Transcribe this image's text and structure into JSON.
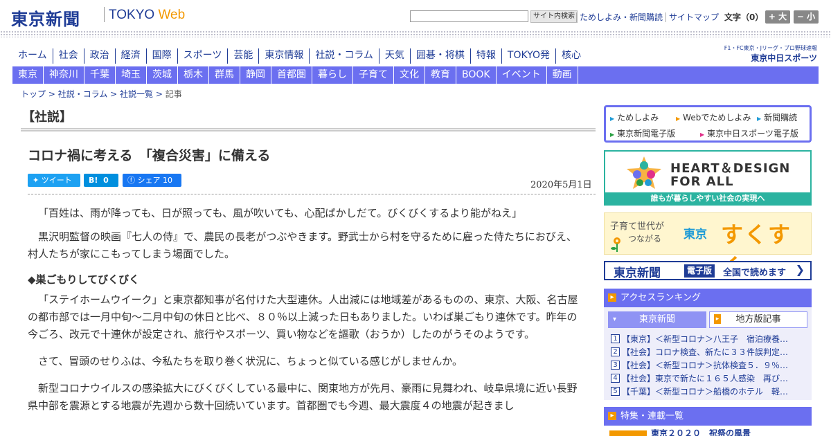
{
  "header": {
    "logo_main": "東京新聞",
    "logo_tokyo": "TOKYO",
    "logo_web": "Web",
    "search_button": "サイト内検索",
    "links": [
      "ためしよみ・新聞購読",
      "サイトマップ"
    ],
    "font_size_label": "文字（0）",
    "font_big": "+ 大",
    "font_small": "− 小"
  },
  "nav_main": [
    "ホーム",
    "社会",
    "政治",
    "経済",
    "国際",
    "スポーツ",
    "芸能",
    "東京情報",
    "社説・コラム",
    "天気",
    "囲碁・将棋",
    "特報",
    "TOKYO発",
    "核心"
  ],
  "sports_logo": {
    "line1": "F1・FC東京・Jリーグ・プロ野球速報",
    "line2": "東京中日スポーツ"
  },
  "nav_region": [
    "東京",
    "神奈川",
    "千葉",
    "埼玉",
    "茨城",
    "栃木",
    "群馬",
    "静岡",
    "首都圏",
    "暮らし",
    "子育て",
    "文化",
    "教育",
    "BOOK",
    "イベント",
    "動画"
  ],
  "breadcrumb": {
    "items": [
      "トップ",
      "社説・コラム",
      "社説一覧"
    ],
    "current": "記事",
    "sep": " > "
  },
  "article": {
    "section": "【社説】",
    "title": "コロナ禍に考える　「複合災害」に備える",
    "share": {
      "tweet": "ツイート",
      "hatena": "B!",
      "hatena_count": "0",
      "fb": "シェア",
      "fb_count": "10"
    },
    "date": "2020年5月1日",
    "p1": "「百姓は、雨が降っても、日が照っても、風が吹いても、心配ばかしだて。びくびくするより能がねえ」",
    "p2": "黒沢明監督の映画『七人の侍』で、農民の長老がつぶやきます。野武士から村を守るために雇った侍たちにおびえ、村人たちが家にこもってしまう場面でした。",
    "h1": "◆巣ごもりしてびくびく",
    "p3": "「ステイホームウイーク」と東京都知事が名付けた大型連休。人出減には地域差があるものの、東京、大阪、名古屋の都市部では一月中旬～二月中旬の休日と比べ、８０％以上減った日もありました。いわば巣ごもり連休です。昨年の今ごろ、改元で十連休が設定され、旅行やスポーツ、買い物などを謳歌（おうか）したのがうそのようです。",
    "p4": "さて、冒頭のせりふは、今私たちを取り巻く状況に、ちょっと似ている感じがしませんか。",
    "p5": "新型コロナウイルスの感染拡大にびくびくしている最中に、関東地方が先月、豪雨に見舞われ、岐阜県境に近い長野県中部を震源とする地震が先週から数十回続いています。首都圏でも今週、最大震度４の地震が起きまし"
  },
  "sidebar": {
    "links": [
      "ためしよみ",
      "Webでためしよみ",
      "新聞購読",
      "東京新聞電子版",
      "東京中日スポーツ電子版"
    ],
    "heart_line1": "HEART＆DESIGN",
    "heart_line2": "FOR ALL",
    "heart_foot": "誰もが暮らしやすい社会の実現へ",
    "suku_t1": "子育て世代が",
    "suku_t2": "つながる",
    "suku_t3": "東京",
    "suku_t4": "すくすく",
    "ep_t1": "東京新聞",
    "ep_t2": "電子版",
    "ep_t3": "全国で読めます",
    "ep_arrow": "❯",
    "ranking_title": "アクセスランキング",
    "ranking_tab_active": "東京新聞",
    "ranking_tab_inactive": "地方版記事",
    "ranking": [
      {
        "num": "1",
        "text": "【東京】＜新型コロナ＞八王子　宿泊療養…"
      },
      {
        "num": "2",
        "text": "【社会】コロナ検査、新たに３３件誤判定…"
      },
      {
        "num": "3",
        "text": "【社会】＜新型コロナ＞抗体検査５．９％…"
      },
      {
        "num": "4",
        "text": "【社会】東京で新たに１６５人感染　再び…"
      },
      {
        "num": "5",
        "text": "【千葉】＜新型コロナ＞船橋のホテル　軽…"
      }
    ],
    "feature_title": "特集・連載一覧",
    "feature_item": "東京２０２０　祝祭の風景"
  }
}
